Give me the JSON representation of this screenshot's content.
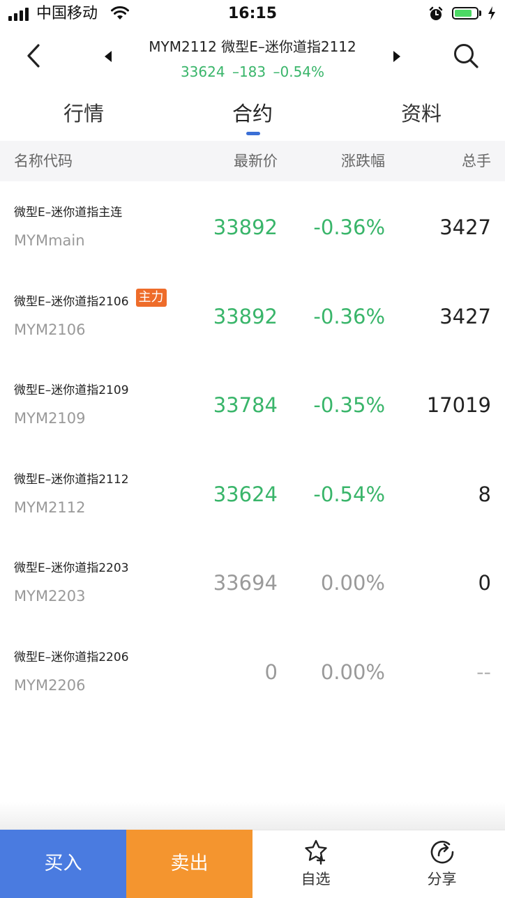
{
  "status_bar": {
    "carrier": "中国移动",
    "time": "16:15"
  },
  "header": {
    "title": "MYM2112 微型E–迷你道指2112",
    "quote": {
      "price": "33624",
      "change": "–183",
      "change_pct": "–0.54%"
    }
  },
  "tabs": [
    {
      "label": "行情",
      "active": false
    },
    {
      "label": "合约",
      "active": true
    },
    {
      "label": "资料",
      "active": false
    }
  ],
  "table": {
    "headers": {
      "name": "名称代码",
      "price": "最新价",
      "change": "涨跌幅",
      "volume": "总手"
    },
    "rows": [
      {
        "name": "微型E–迷你道指主连",
        "code": "MYMmain",
        "price": "33892",
        "change": "-0.36%",
        "volume": "3427",
        "badge": ""
      },
      {
        "name": "微型E–迷你道指2106",
        "code": "MYM2106",
        "price": "33892",
        "change": "-0.36%",
        "volume": "3427",
        "badge": "主力"
      },
      {
        "name": "微型E–迷你道指2109",
        "code": "MYM2109",
        "price": "33784",
        "change": "-0.35%",
        "volume": "17019",
        "badge": ""
      },
      {
        "name": "微型E–迷你道指2112",
        "code": "MYM2112",
        "price": "33624",
        "change": "-0.54%",
        "volume": "8",
        "badge": ""
      },
      {
        "name": "微型E–迷你道指2203",
        "code": "MYM2203",
        "price": "33694",
        "change": "0.00%",
        "volume": "0",
        "badge": ""
      },
      {
        "name": "微型E–迷你道指2206",
        "code": "MYM2206",
        "price": "0",
        "change": "0.00%",
        "volume": "--",
        "badge": ""
      }
    ]
  },
  "bottom_bar": {
    "buy_label": "买入",
    "sell_label": "卖出",
    "watch_label": "自选",
    "share_label": "分享"
  },
  "colors": {
    "down_green": "#39b56a",
    "neutral_gray": "#9a9a9a",
    "buy_blue": "#4a7be0",
    "sell_orange": "#f4952f",
    "badge_orange": "#ee6c2a",
    "tab_indicator": "#3b6fd6"
  },
  "icons": {
    "back": "chevron-left-icon",
    "prev": "triangle-left-icon",
    "next": "triangle-right-icon",
    "search": "search-icon",
    "watch": "star-plus-icon",
    "share": "share-icon"
  }
}
